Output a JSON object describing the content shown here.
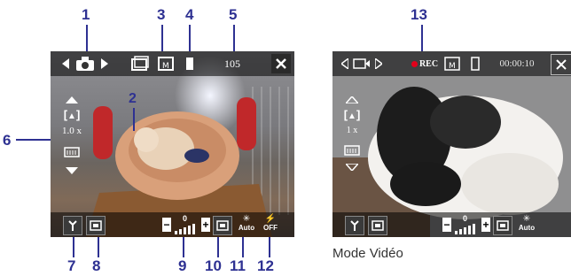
{
  "callouts": {
    "c1": "1",
    "c2": "2",
    "c3": "3",
    "c4": "4",
    "c5": "5",
    "c6": "6",
    "c7": "7",
    "c8": "8",
    "c9": "9",
    "c10": "10",
    "c11": "11",
    "c12": "12",
    "c13": "13"
  },
  "photo": {
    "shots_remaining": "105",
    "zoom_level": "1.0 x",
    "brightness_value": "0",
    "auto_label": "Auto",
    "off_label": "OFF"
  },
  "video": {
    "rec_label": "REC",
    "timer": "00:00:10",
    "zoom_level": "1 x",
    "brightness_value": "0",
    "auto_label": "Auto"
  },
  "caption": "Mode Vidéo",
  "colors": {
    "callout": "#2e3192",
    "rec_dot": "#e3001b",
    "toolbar_bg": "#1a1a1a",
    "close_bg": "#2a2a2a"
  },
  "icons": {
    "mode": "camera-icon",
    "video_mode": "videocam-icon",
    "close": "close-icon",
    "storage": "memory-card-icon"
  }
}
